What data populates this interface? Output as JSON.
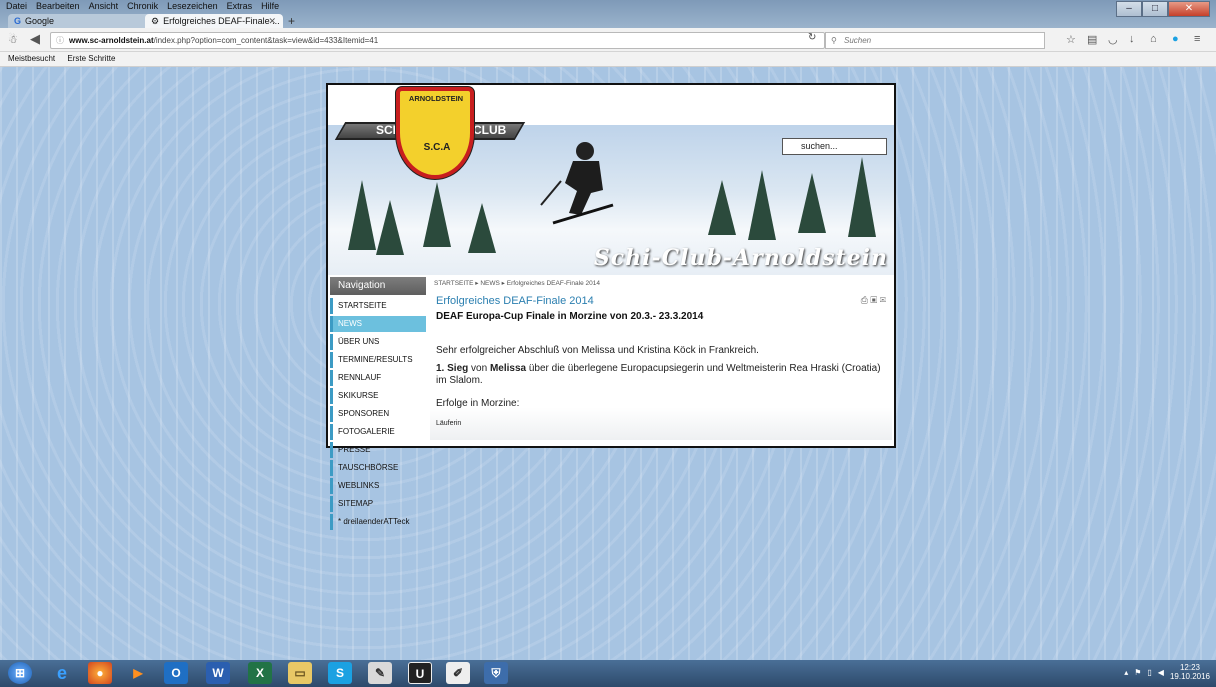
{
  "browser": {
    "menu": [
      "Datei",
      "Bearbeiten",
      "Ansicht",
      "Chronik",
      "Lesezeichen",
      "Extras",
      "Hilfe"
    ],
    "tabs": [
      {
        "label": "Google"
      },
      {
        "label": "Erfolgreiches DEAF-Finale ..."
      }
    ],
    "url_host": "www.sc-arnoldstein.at",
    "url_path": "/index.php?option=com_content&task=view&id=433&Itemid=41",
    "search_placeholder": "Suchen",
    "bookmarks": [
      "Meistbesucht",
      "Erste Schritte"
    ]
  },
  "site": {
    "logo": {
      "top": "ARNOLDSTEIN",
      "left": "SCHI-",
      "right": "CLUB",
      "bottom": "S.C.A"
    },
    "search_placeholder": "suchen...",
    "banner_script": "Schi-Club-Arnoldstein",
    "navigation": {
      "heading": "Navigation",
      "items": [
        "STARTSEITE",
        "NEWS",
        "ÜBER UNS",
        "TERMINE/RESULTS",
        "RENNLAUF",
        "SKIKURSE",
        "SPONSOREN",
        "FOTOGALERIE",
        "PRESSE",
        "TAUSCHBÖRSE",
        "WEBLINKS",
        "SITEMAP",
        "* dreilaenderATTeck"
      ]
    },
    "breadcrumb": "STARTSEITE ▸ NEWS ▸ Erfolgreiches DEAF-Finale 2014",
    "article": {
      "title": "Erfolgreiches DEAF-Finale 2014",
      "subtitle": "DEAF Europa-Cup Finale in Morzine von 20.3.- 23.3.2014",
      "p1": "Sehr erfolgreicher Abschluß von Melissa und Kristina Köck in Frankreich.",
      "p2_lead": "1. Sieg",
      "p2_mid1": " von ",
      "p2_name": "Melissa",
      "p2_rest": " über die überlegene Europacupsiegerin und Weltmeisterin  Rea Hraski (Croatia) im Slalom.",
      "p3": "Erfolge in Morzine:",
      "p4": "Läuferin"
    }
  },
  "taskbar": {
    "time": "12:23",
    "date": "19.10.2016"
  }
}
